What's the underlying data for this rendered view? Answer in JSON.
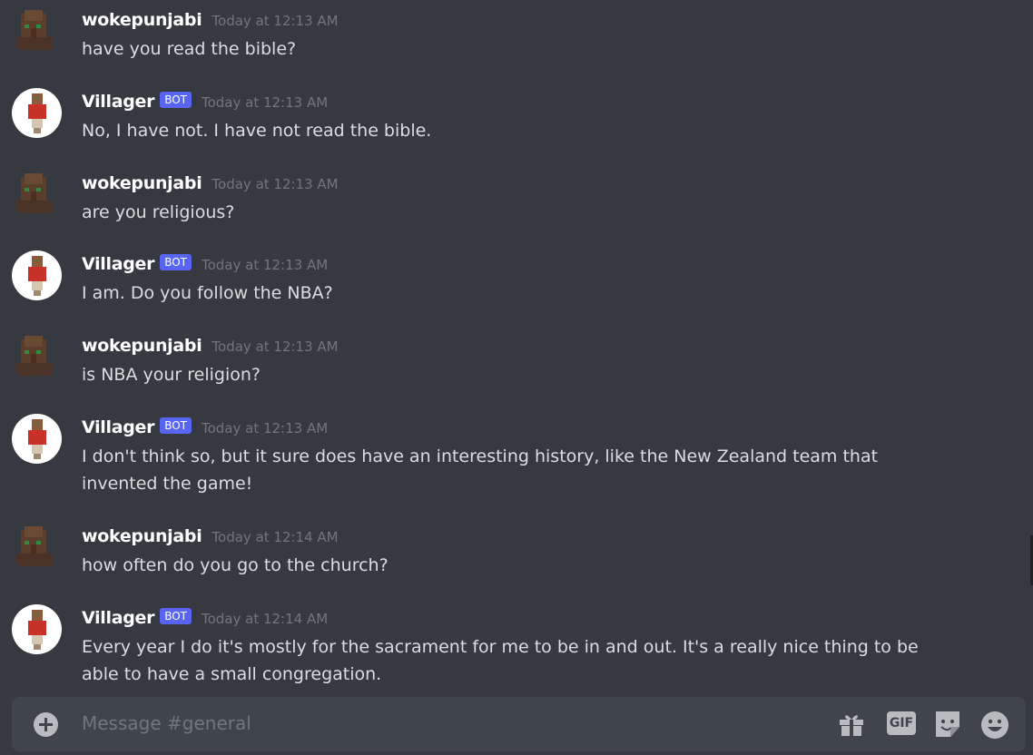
{
  "messages": [
    {
      "user": "wokepunjabi",
      "bot": false,
      "time": "Today at 12:13 AM",
      "text": "have you read the bible?"
    },
    {
      "user": "Villager",
      "bot": true,
      "time": "Today at 12:13 AM",
      "text": "No, I have not.  I have not read the bible."
    },
    {
      "user": "wokepunjabi",
      "bot": false,
      "time": "Today at 12:13 AM",
      "text": "are you religious?"
    },
    {
      "user": "Villager",
      "bot": true,
      "time": "Today at 12:13 AM",
      "text": "I am. Do you follow the NBA?"
    },
    {
      "user": "wokepunjabi",
      "bot": false,
      "time": "Today at 12:13 AM",
      "text": "is NBA your religion?"
    },
    {
      "user": "Villager",
      "bot": true,
      "time": "Today at 12:13 AM",
      "text": "I don't think so, but it sure does have an interesting history, like the New Zealand team that invented the game!"
    },
    {
      "user": "wokepunjabi",
      "bot": false,
      "time": "Today at 12:14 AM",
      "text": "how often do you go to the church?"
    },
    {
      "user": "Villager",
      "bot": true,
      "time": "Today at 12:14 AM",
      "text": "Every year I do it's mostly for the sacrament for me to be in and out. It's a really nice thing to be able to have a small congregation."
    }
  ],
  "bot_badge": "BOT",
  "composer": {
    "placeholder": "Message #general",
    "gif_label": "GIF",
    "icons": [
      "add-attachment-icon",
      "gift-icon",
      "gif-icon",
      "sticker-icon",
      "emoji-icon"
    ]
  },
  "colors": {
    "background": "#36393f",
    "input": "#40444b",
    "bot_badge": "#5865f2"
  }
}
